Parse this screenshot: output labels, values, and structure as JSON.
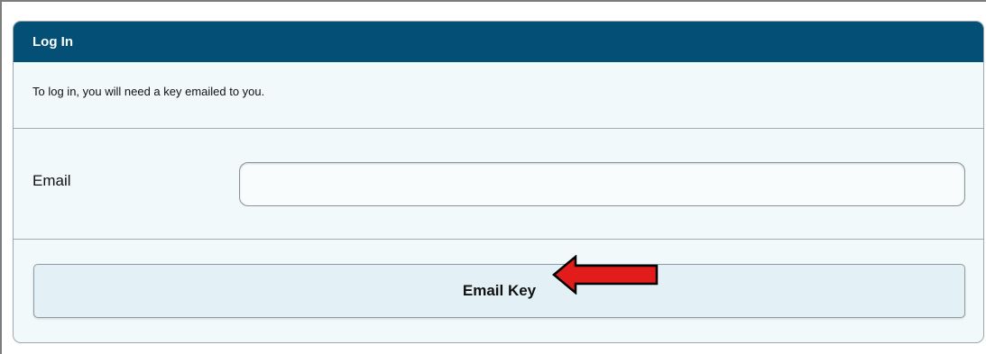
{
  "panel": {
    "title": "Log In",
    "intro": "To log in, you will need a key emailed to you."
  },
  "form": {
    "email_label": "Email",
    "email_value": "",
    "email_placeholder": "",
    "submit_label": "Email Key"
  },
  "annotation": {
    "icon": "red-arrow-left-icon",
    "color": "#e21b1b"
  },
  "colors": {
    "header": "#034f75",
    "panel_bg": "#f1f9fb",
    "button_bg": "#e3f1f6"
  }
}
